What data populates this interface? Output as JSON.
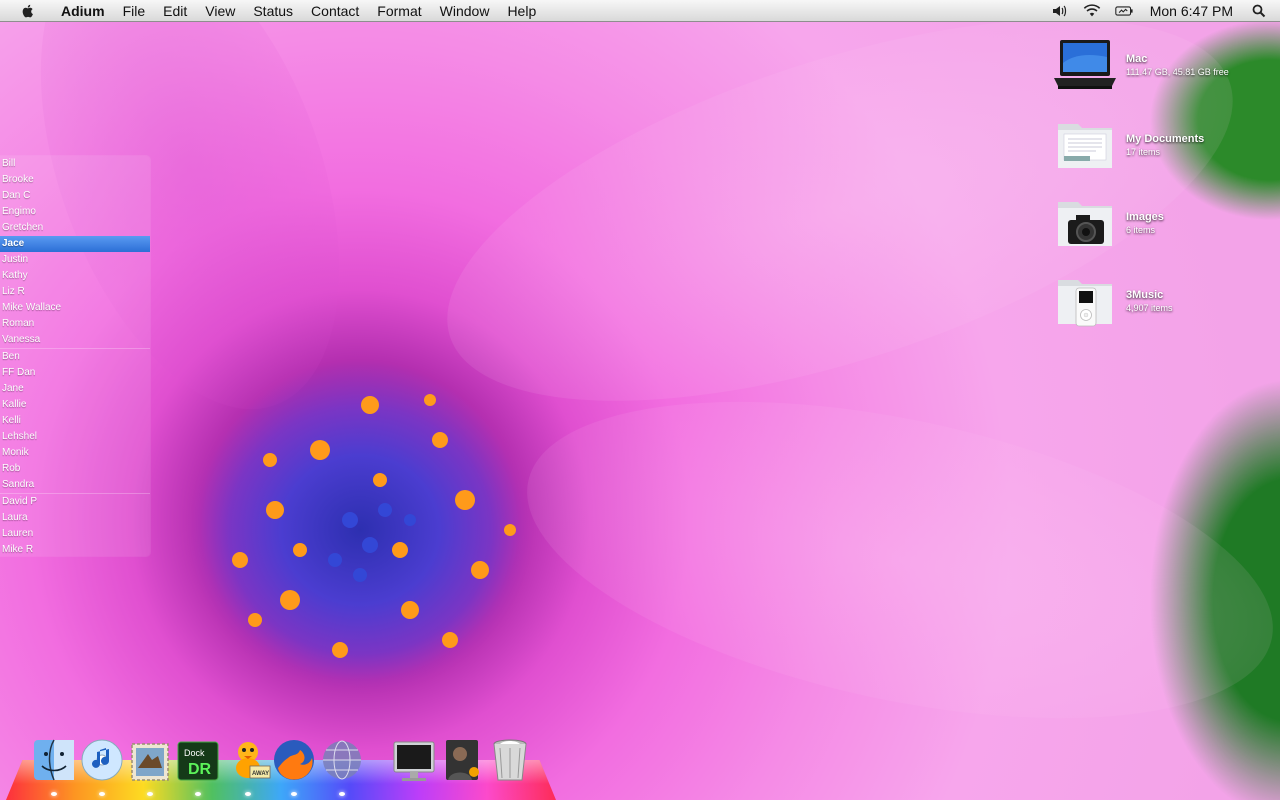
{
  "menubar": {
    "app_name": "Adium",
    "menus": [
      "File",
      "Edit",
      "View",
      "Status",
      "Contact",
      "Format",
      "Window",
      "Help"
    ],
    "clock": "Mon 6:47 PM",
    "status_icons": [
      "volume-icon",
      "wifi-icon",
      "battery-icon",
      "spotlight-icon"
    ]
  },
  "contacts": {
    "groups": [
      [
        "Bill",
        "Brooke",
        "Dan C",
        "Engimo",
        "Gretchen",
        "Jace",
        "Justin",
        "Kathy",
        "Liz R",
        "Mike Wallace",
        "Roman",
        "Vanessa"
      ],
      [
        "Ben",
        "FF Dan",
        "Jane",
        "Kallie",
        "Kelli",
        "Lehshel",
        "Monik",
        "Rob",
        "Sandra"
      ],
      [
        "David P",
        "Laura",
        "Lauren",
        "Mike R"
      ]
    ],
    "selected": "Jace"
  },
  "desktop_icons": [
    {
      "name": "Mac",
      "sub": "111.47 GB, 45.81 GB free",
      "icon": "macbook-icon"
    },
    {
      "name": "My Documents",
      "sub": "17 items",
      "icon": "documents-folder-icon"
    },
    {
      "name": "Images",
      "sub": "6 items",
      "icon": "camera-folder-icon"
    },
    {
      "name": "3Music",
      "sub": "4,907 items",
      "icon": "ipod-folder-icon"
    }
  ],
  "dock": {
    "items": [
      "finder-icon",
      "itunes-icon",
      "mail-icon",
      "dockdr-icon",
      "adium-duck-icon",
      "firefox-icon",
      "network-globe-icon",
      "display-icon",
      "person-icon",
      "trash-icon"
    ],
    "dockdr_text": "Dock DR",
    "away_text": "AWAY"
  }
}
